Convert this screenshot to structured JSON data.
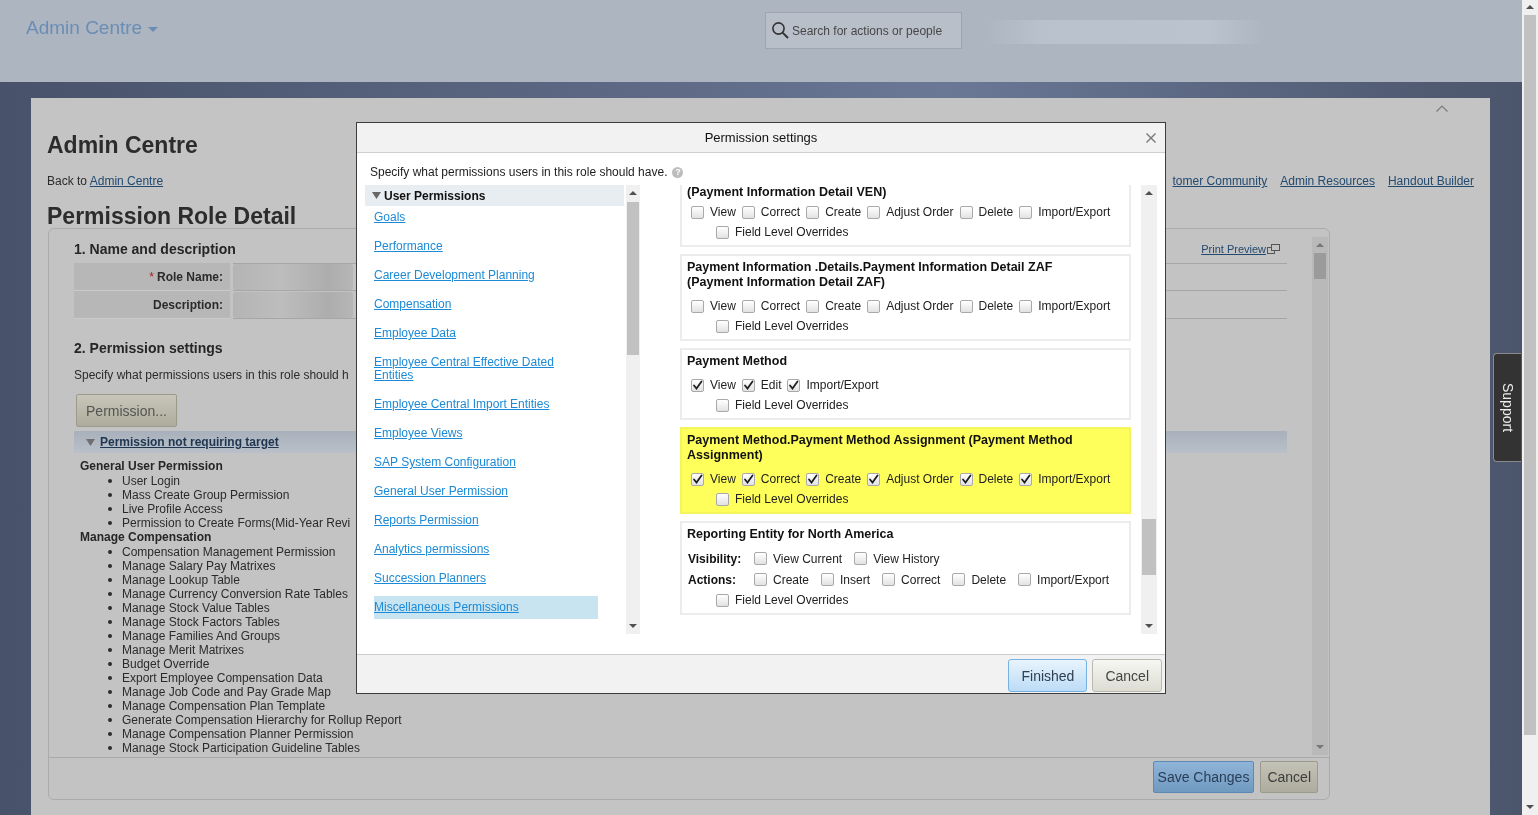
{
  "header": {
    "app_menu": "Admin Centre",
    "search": {
      "placeholder": "Search for actions or people"
    }
  },
  "page": {
    "title": "Admin Centre",
    "back_prefix": "Back to",
    "back_link": "Admin Centre",
    "links": [
      "tomer Community",
      "Admin Resources",
      "Handout Builder"
    ],
    "subtitle": "Permission Role Detail",
    "name_section": {
      "heading": "1. Name and description",
      "print_preview": "Print Preview",
      "fields": [
        {
          "required_mark": "*",
          "label": "Role Name:"
        },
        {
          "label": "Description:"
        }
      ]
    },
    "permission_section": {
      "heading": "2. Permission settings",
      "description": "Specify what permissions users in this role should h",
      "button": "Permission...",
      "group": {
        "label": "Permission not requiring target",
        "expanded": true,
        "categories": [
          {
            "name": "General User Permission",
            "items": [
              "User Login",
              "Mass Create Group Permission",
              "Live Profile Access",
              "Permission to Create Forms(Mid-Year Revi"
            ]
          },
          {
            "name": "Manage Compensation",
            "items": [
              "Compensation Management Permission",
              "Manage Salary Pay Matrixes",
              "Manage Lookup Table",
              "Manage Currency Conversion Rate Tables",
              "Manage Stock Value Tables",
              "Manage Stock Factors Tables",
              "Manage Families And Groups",
              "Manage Merit Matrixes",
              "Budget Override",
              "Export Employee Compensation Data",
              "Manage Job Code and Pay Grade Map",
              "Manage Compensation Plan Template",
              "Generate Compensation Hierarchy for Rollup Report",
              "Manage Compensation Planner Permission",
              "Manage Stock Participation Guideline Tables"
            ]
          }
        ]
      }
    },
    "buttons": [
      {
        "label": "Save Changes",
        "kind": "primary"
      },
      {
        "label": "Cancel",
        "kind": "secondary"
      }
    ]
  },
  "support_tab": "Support",
  "dialog": {
    "title": "Permission settings",
    "intro": "Specify what permissions users in this role should have.",
    "help_icon": "?",
    "nav": {
      "heading": "User Permissions",
      "expanded": true,
      "items": [
        {
          "label": "Goals",
          "selected": false
        },
        {
          "label": "Performance",
          "selected": false
        },
        {
          "label": "Career Development Planning",
          "selected": false
        },
        {
          "label": "Compensation",
          "selected": false
        },
        {
          "label": "Employee Data",
          "selected": false
        },
        {
          "label": "Employee Central Effective Dated Entities",
          "selected": false
        },
        {
          "label": "Employee Central Import Entities",
          "selected": false
        },
        {
          "label": "Employee Views",
          "selected": false
        },
        {
          "label": "SAP System Configuration",
          "selected": false
        },
        {
          "label": "General User Permission",
          "selected": false
        },
        {
          "label": "Reports Permission",
          "selected": false
        },
        {
          "label": "Analytics permissions",
          "selected": false
        },
        {
          "label": "Succession Planners",
          "selected": false
        },
        {
          "label": "Miscellaneous Permissions",
          "selected": true
        }
      ]
    },
    "sections": [
      {
        "title": "(Payment Information Detail VEN)",
        "highlighted": false,
        "rows": [
          {
            "options": [
              {
                "label": "View",
                "checked": false
              },
              {
                "label": "Correct",
                "checked": false
              },
              {
                "label": "Create",
                "checked": false
              },
              {
                "label": "Adjust Order",
                "checked": false
              },
              {
                "label": "Delete",
                "checked": false
              },
              {
                "label": "Import/Export",
                "checked": false
              }
            ]
          }
        ],
        "overrides": {
          "label": "Field Level Overrides",
          "checked": false
        }
      },
      {
        "title": "Payment Information .Details.Payment Information Detail ZAF (Payment Information Detail ZAF)",
        "highlighted": false,
        "rows": [
          {
            "options": [
              {
                "label": "View",
                "checked": false
              },
              {
                "label": "Correct",
                "checked": false
              },
              {
                "label": "Create",
                "checked": false
              },
              {
                "label": "Adjust Order",
                "checked": false
              },
              {
                "label": "Delete",
                "checked": false
              },
              {
                "label": "Import/Export",
                "checked": false
              }
            ]
          }
        ],
        "overrides": {
          "label": "Field Level Overrides",
          "checked": false
        }
      },
      {
        "title": "Payment Method",
        "highlighted": false,
        "rows": [
          {
            "options": [
              {
                "label": "View",
                "checked": true
              },
              {
                "label": "Edit",
                "checked": true
              },
              {
                "label": "Import/Export",
                "checked": true
              }
            ]
          }
        ],
        "overrides": {
          "label": "Field Level Overrides",
          "checked": false
        }
      },
      {
        "title": "Payment Method.Payment Method Assignment (Payment Method Assignment)",
        "highlighted": true,
        "rows": [
          {
            "options": [
              {
                "label": "View",
                "checked": true
              },
              {
                "label": "Correct",
                "checked": true
              },
              {
                "label": "Create",
                "checked": true
              },
              {
                "label": "Adjust Order",
                "checked": true
              },
              {
                "label": "Delete",
                "checked": true
              },
              {
                "label": "Import/Export",
                "checked": true
              }
            ]
          }
        ],
        "overrides": {
          "label": "Field Level Overrides",
          "checked": false
        }
      },
      {
        "title": "Reporting Entity for North America",
        "highlighted": false,
        "rows": [
          {
            "label": "Visibility:",
            "options": [
              {
                "label": "View Current",
                "checked": false
              },
              {
                "label": "View History",
                "checked": false
              }
            ]
          },
          {
            "label": "Actions:",
            "options": [
              {
                "label": "Create",
                "checked": false
              },
              {
                "label": "Insert",
                "checked": false
              },
              {
                "label": "Correct",
                "checked": false
              },
              {
                "label": "Delete",
                "checked": false
              },
              {
                "label": "Import/Export",
                "checked": false
              }
            ]
          }
        ],
        "overrides": {
          "label": "Field Level Overrides",
          "checked": false
        }
      }
    ],
    "buttons": [
      {
        "label": "Finished",
        "kind": "primary"
      },
      {
        "label": "Cancel",
        "kind": "secondary"
      }
    ]
  }
}
